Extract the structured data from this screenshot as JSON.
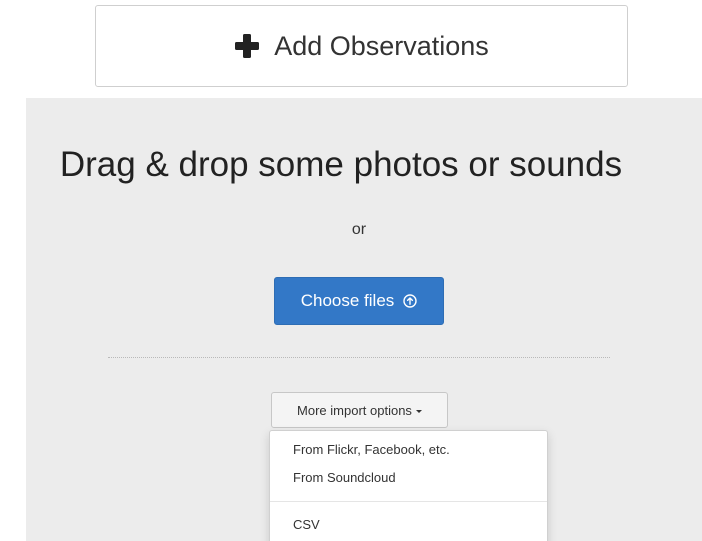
{
  "header": {
    "add_observations_label": "Add Observations",
    "add_icon": "plus-icon"
  },
  "dropzone": {
    "title": "Drag & drop some photos or sounds",
    "or_text": "or",
    "choose_files_label": "Choose files",
    "choose_files_icon": "upload-circle-icon",
    "more_import_label": "More import options",
    "more_import_icon": "caret-down-icon"
  },
  "import_menu": {
    "items": [
      {
        "label": "From Flickr, Facebook, etc."
      },
      {
        "label": "From Soundcloud"
      },
      {
        "label": "CSV"
      }
    ]
  },
  "colors": {
    "primary_button": "#3378c7",
    "dropzone_background": "#ececec",
    "text": "#333333"
  }
}
